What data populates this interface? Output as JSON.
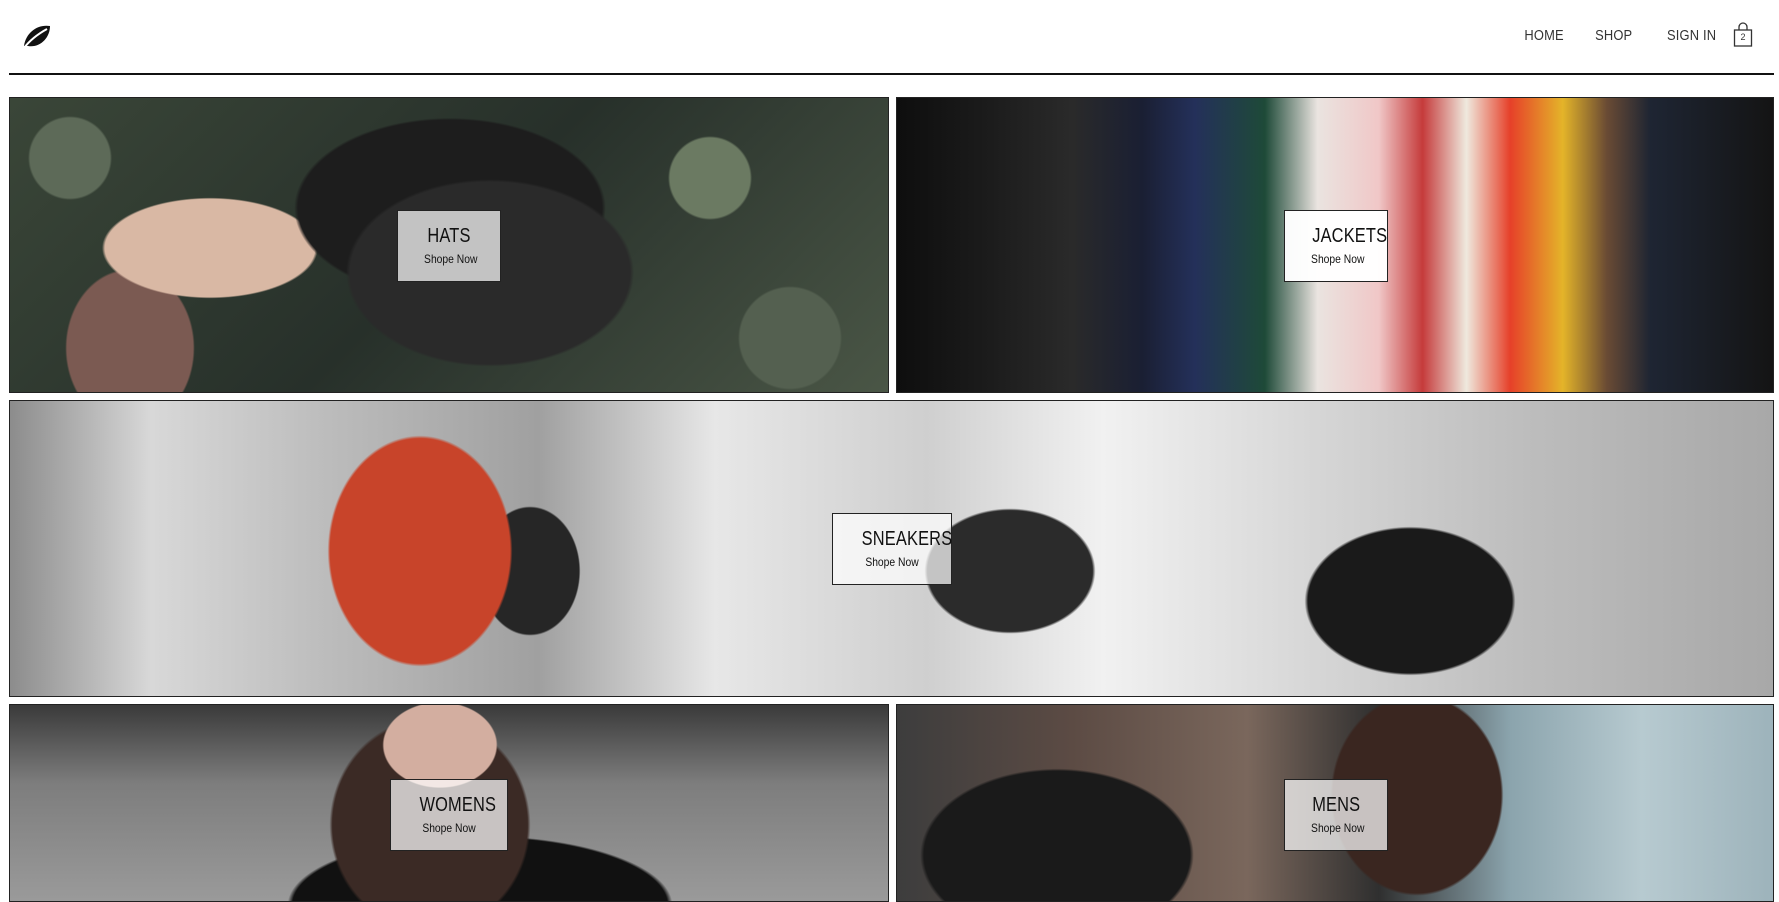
{
  "header": {
    "logo_icon": "leaf-icon",
    "nav": {
      "home": "HOME",
      "shop": "SHOP",
      "sign_in": "SIGN IN"
    },
    "cart": {
      "icon": "shopping-bag-icon",
      "count": "2"
    }
  },
  "categories": [
    {
      "title": "HATS",
      "subtitle": "Shope Now"
    },
    {
      "title": "JACKETS",
      "subtitle": "Shope Now"
    },
    {
      "title": "SNEAKERS",
      "subtitle": "Shope Now"
    },
    {
      "title": "WOMENS",
      "subtitle": "Shope Now"
    },
    {
      "title": "MENS",
      "subtitle": "Shope Now"
    }
  ]
}
